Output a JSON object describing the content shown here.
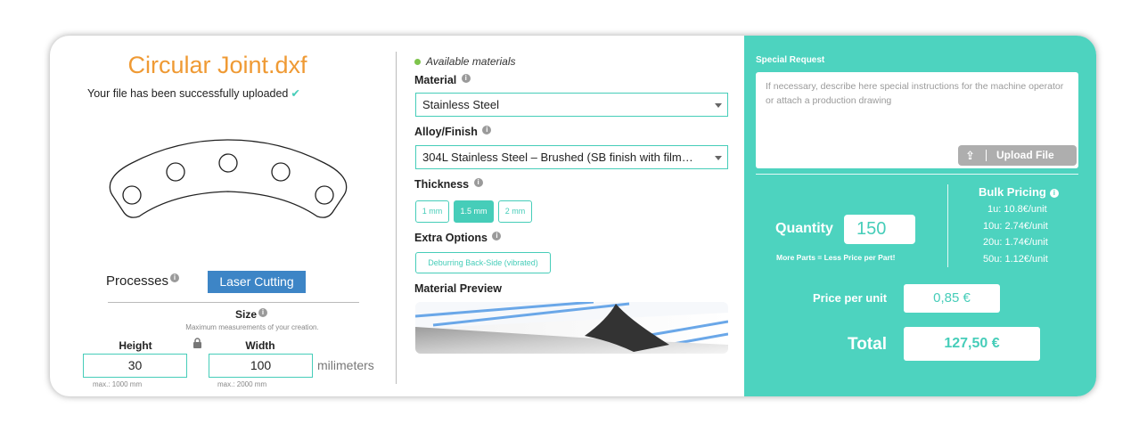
{
  "file": {
    "title": "Circular Joint.dxf",
    "upload_status": "Your file has been successfully uploaded",
    "check_icon": "check-icon"
  },
  "processes": {
    "label": "Processes",
    "selected": "Laser Cutting"
  },
  "size": {
    "label": "Size",
    "hint": "Maximum measurements of your creation.",
    "height_label": "Height",
    "height_value": "30",
    "height_max": "max.: 1000 mm",
    "width_label": "Width",
    "width_value": "100",
    "width_max": "max.: 2000 mm",
    "unit": "milimeters"
  },
  "config": {
    "availability": "Available materials",
    "material_label": "Material",
    "material_value": "Stainless Steel",
    "alloy_label": "Alloy/Finish",
    "alloy_value": "304L Stainless Steel – Brushed (SB finish with film…",
    "thickness_label": "Thickness",
    "thickness_options": [
      "1 mm",
      "1.5 mm",
      "2 mm"
    ],
    "thickness_selected": "1.5 mm",
    "extra_label": "Extra Options",
    "extra_option": "Deburring Back-Side (vibrated)",
    "preview_label": "Material Preview"
  },
  "order": {
    "special_request_label": "Special Request",
    "special_request_placeholder": "If necessary, describe here special instructions for the machine operator or attach a production drawing",
    "upload_label": "Upload File",
    "quantity_label": "Quantity",
    "quantity_value": "150",
    "quantity_note": "More Parts = Less Price per Part!",
    "bulk_title": "Bulk Pricing",
    "bulk_rows": [
      "1u: 10.8€/unit",
      "10u: 2.74€/unit",
      "20u: 1.74€/unit",
      "50u: 1.12€/unit"
    ],
    "ppu_label": "Price per unit",
    "ppu_value": "0,85 €",
    "total_label": "Total",
    "total_value": "127,50 €"
  },
  "colors": {
    "accent": "#46cdb9",
    "panel": "#4dd3bf",
    "title": "#ef9a34",
    "button": "#3d85c6"
  }
}
